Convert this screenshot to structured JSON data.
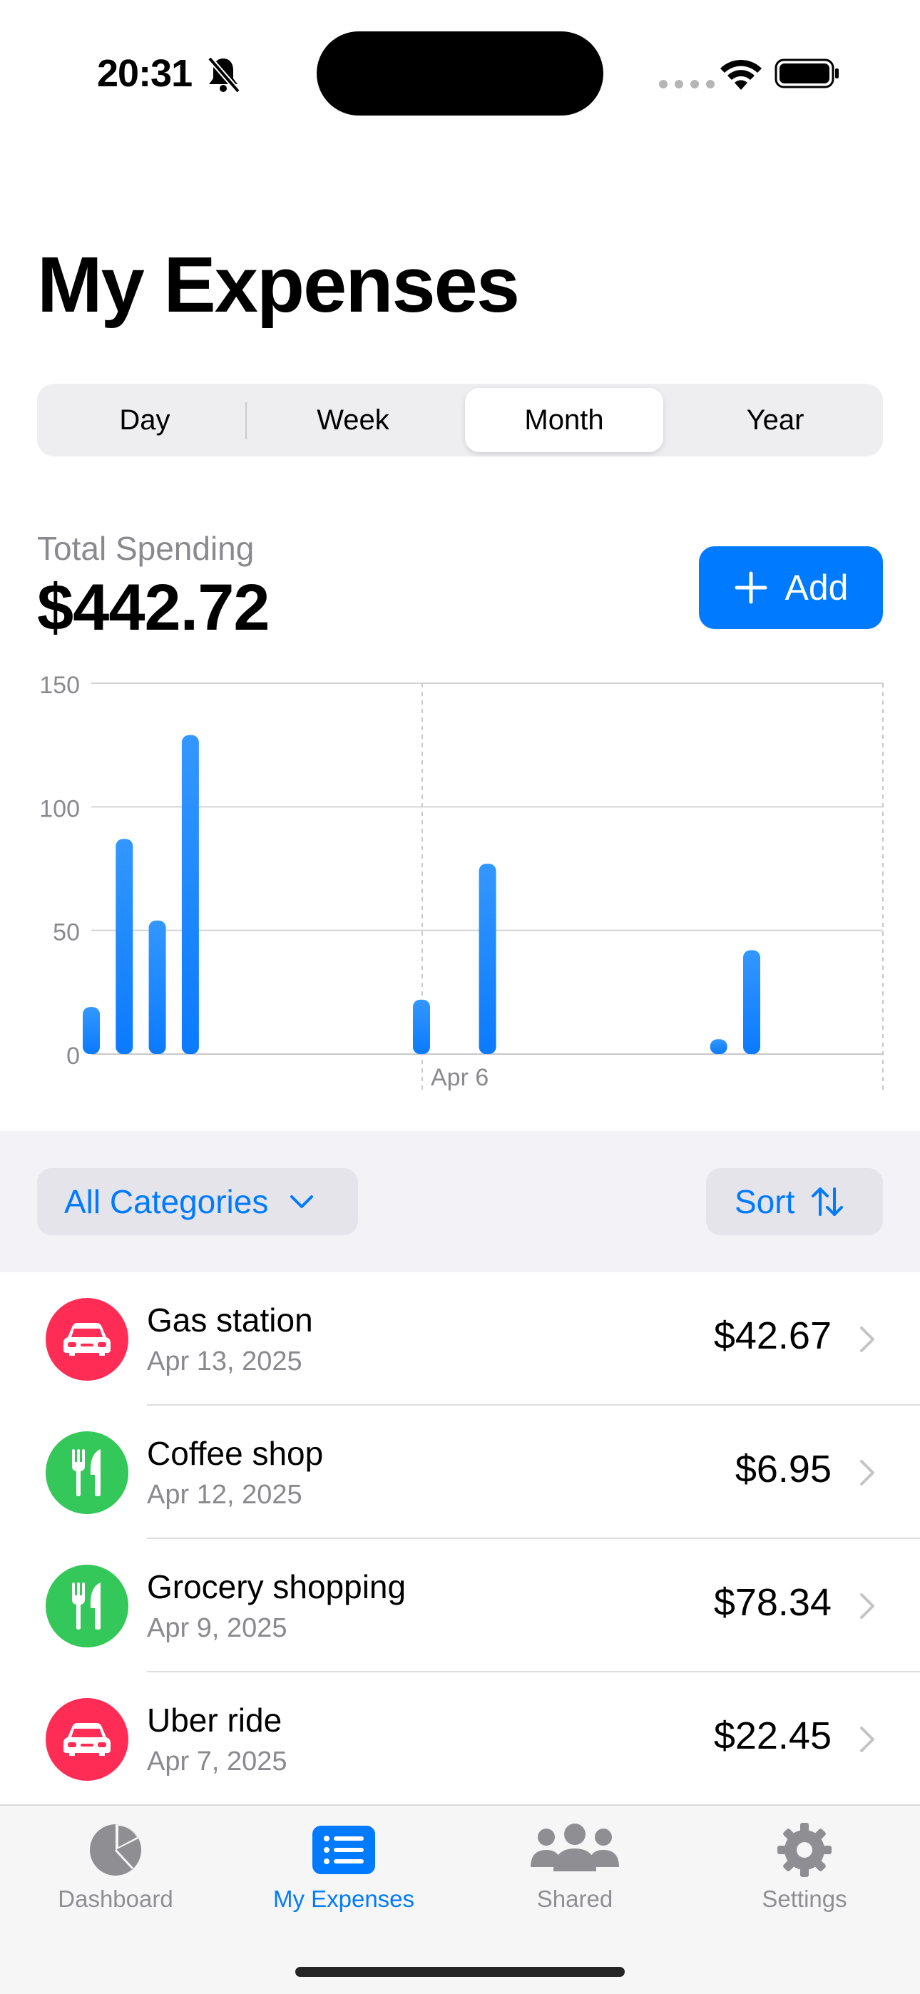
{
  "status_bar": {
    "time": "20:31"
  },
  "header": {
    "title": "My Expenses"
  },
  "segments": [
    {
      "label": "Day",
      "selected": false
    },
    {
      "label": "Week",
      "selected": false
    },
    {
      "label": "Month",
      "selected": true
    },
    {
      "label": "Year",
      "selected": false
    }
  ],
  "summary": {
    "label": "Total Spending",
    "total": "$442.72",
    "add_label": "Add"
  },
  "chart_data": {
    "type": "bar",
    "ylim": [
      0,
      150
    ],
    "yticks": [
      0,
      50,
      100,
      150
    ],
    "x_tick_labels": [
      "Apr 6"
    ],
    "bar_color": "#1a8cff",
    "values": [
      19,
      87,
      54,
      129,
      0,
      0,
      0,
      0,
      0,
      0,
      22,
      0,
      77,
      0,
      0,
      0,
      0,
      0,
      0,
      6,
      42
    ]
  },
  "filters": {
    "categories_label": "All Categories",
    "sort_label": "Sort"
  },
  "expenses": [
    {
      "title": "Gas station",
      "date": "Apr 13, 2025",
      "amount": "$42.67",
      "category": "car-icon",
      "color": "#ff2d55"
    },
    {
      "title": "Coffee shop",
      "date": "Apr 12, 2025",
      "amount": "$6.95",
      "category": "fork-knife-icon",
      "color": "#34c759"
    },
    {
      "title": "Grocery shopping",
      "date": "Apr 9, 2025",
      "amount": "$78.34",
      "category": "fork-knife-icon",
      "color": "#34c759"
    },
    {
      "title": "Uber ride",
      "date": "Apr 7, 2025",
      "amount": "$22.45",
      "category": "car-icon",
      "color": "#ff2d55"
    }
  ],
  "tabs": [
    {
      "label": "Dashboard",
      "icon": "pie-chart-icon",
      "active": false
    },
    {
      "label": "My Expenses",
      "icon": "list-icon",
      "active": true
    },
    {
      "label": "Shared",
      "icon": "people-icon",
      "active": false
    },
    {
      "label": "Settings",
      "icon": "gear-icon",
      "active": false
    }
  ],
  "colors": {
    "accent": "#007aff",
    "tab_inactive": "#8e8e93"
  }
}
